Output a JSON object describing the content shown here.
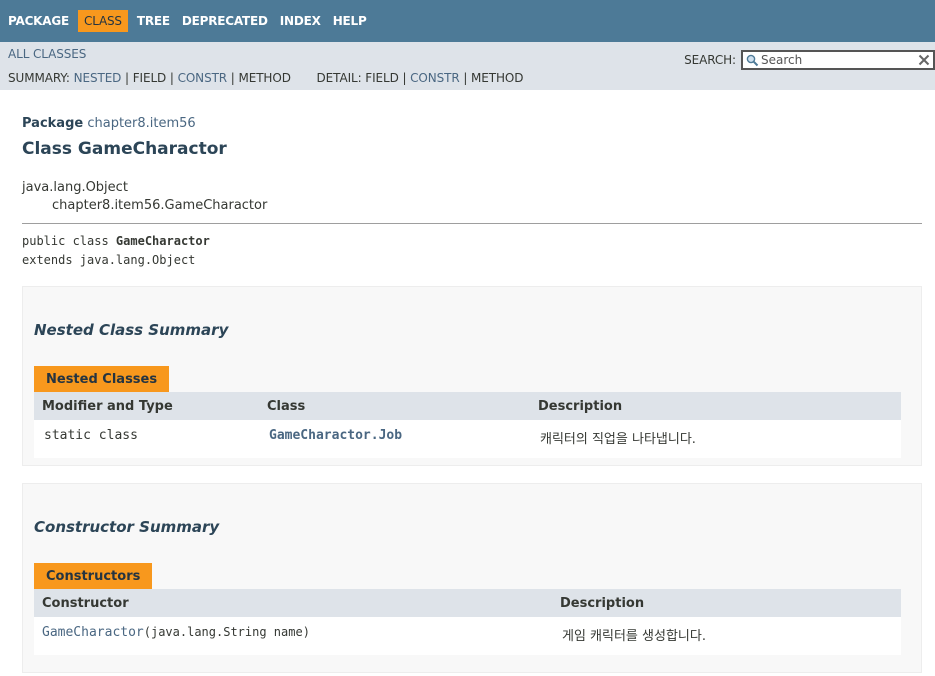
{
  "topnav": {
    "items": [
      {
        "label": "PACKAGE",
        "active": false
      },
      {
        "label": "CLASS",
        "active": true
      },
      {
        "label": "TREE",
        "active": false
      },
      {
        "label": "DEPRECATED",
        "active": false
      },
      {
        "label": "INDEX",
        "active": false
      },
      {
        "label": "HELP",
        "active": false
      }
    ]
  },
  "subnav": {
    "all_classes": "ALL CLASSES",
    "summary_label": "SUMMARY:",
    "summary_nested": "NESTED",
    "summary_field": "FIELD",
    "summary_constr": "CONSTR",
    "summary_method": "METHOD",
    "detail_label": "DETAIL:",
    "detail_field": "FIELD",
    "detail_constr": "CONSTR",
    "detail_method": "METHOD",
    "separator": "|",
    "search_label": "SEARCH:",
    "search_placeholder": "Search",
    "search_value": ""
  },
  "header": {
    "package_label": "Package",
    "package_name": "chapter8.item56",
    "class_title": "Class GameCharactor"
  },
  "inheritance": {
    "root": "java.lang.Object",
    "child": "chapter8.item56.GameCharactor"
  },
  "declaration": {
    "prefix": "public class ",
    "name": "GameCharactor",
    "extends": "extends java.lang.Object"
  },
  "nested_summary": {
    "heading": "Nested Class Summary",
    "caption": "Nested Classes",
    "columns": [
      "Modifier and Type",
      "Class",
      "Description"
    ],
    "rows": [
      {
        "modifier": "static class",
        "class": "GameCharactor.Job",
        "description": "캐릭터의 직업을 나타냅니다."
      }
    ]
  },
  "constructor_summary": {
    "heading": "Constructor Summary",
    "caption": "Constructors",
    "columns": [
      "Constructor",
      "Description"
    ],
    "rows": [
      {
        "name": "GameCharactor",
        "params": "(java.lang.String name)",
        "description": "게임 캐릭터를 생성합니다."
      }
    ]
  },
  "colors": {
    "topnav_bg": "#4D7A97",
    "subnav_bg": "#dee3e9",
    "accent": "#F8981D",
    "link": "#4A6782"
  }
}
